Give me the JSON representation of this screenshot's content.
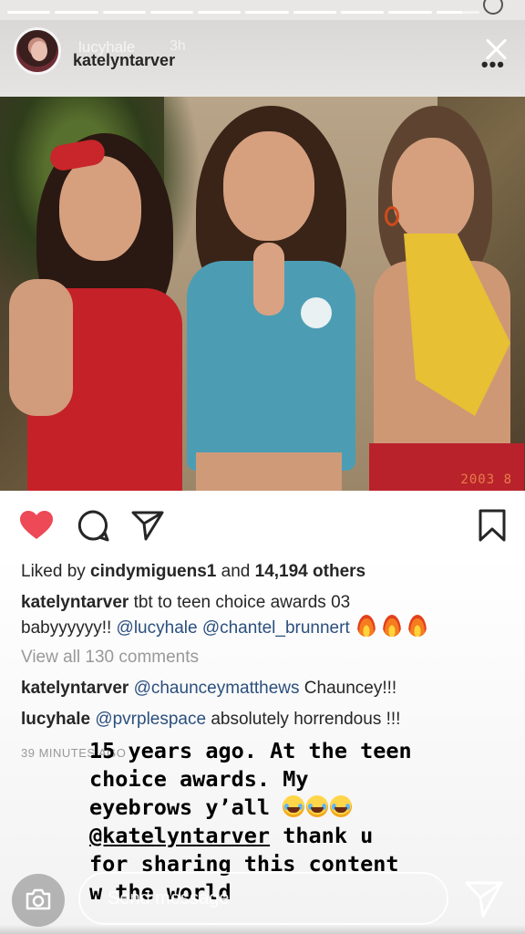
{
  "story": {
    "progress_segments": 10,
    "progress_current_index": 9,
    "header": {
      "story_user": "lucyhale",
      "story_time": "3h",
      "post_user": "katelyntarver",
      "more_label": "•••"
    },
    "photo": {
      "date_stamp": "2003 8"
    },
    "actions": {
      "liked": true,
      "like_color": "#ed4956"
    },
    "likes": {
      "prefix": "Liked by ",
      "user": "cindymiguens1",
      "middle": " and ",
      "count": "14,194 others"
    },
    "caption": {
      "user": "katelyntarver",
      "text_line1": " tbt to teen choice awards 03",
      "text_line2_plain": "babyyyyyy!! ",
      "mention1": "@lucyhale",
      "mention2": "@chantel_brunnert"
    },
    "view_all": "View all 130 comments",
    "comments": [
      {
        "user": "katelyntarver",
        "mention": "@chaunceymatthews",
        "text": " Chauncey!!!"
      },
      {
        "user": "lucyhale",
        "mention": "@pvrplespace",
        "text": " absolutely horrendous !!!"
      }
    ],
    "time_ago": "39 MINUTES AGO",
    "overlay": {
      "line1": "15 years ago. At the teen",
      "line2": "choice awards. My",
      "line3": "eyebrows y’all ",
      "line4_mention": "@katelyntarver",
      "line4_rest": " thank u",
      "line5": "for sharing this content",
      "line6": "w the world"
    },
    "bottom": {
      "message_placeholder": "Send message"
    }
  }
}
